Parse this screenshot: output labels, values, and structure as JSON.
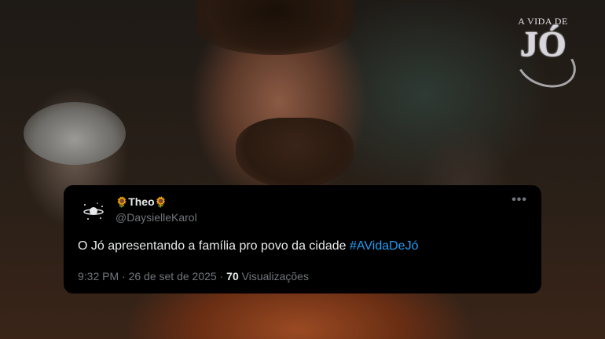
{
  "logo": {
    "top_text": "A VIDA DE",
    "main_text": "JÓ"
  },
  "tweet": {
    "display_name": "Theo",
    "name_emoji": "🌻",
    "handle": "@DaysielleKarol",
    "more_icon": "more-icon",
    "text": "O Jó apresentando a família pro povo da cidade ",
    "hashtag": "#AVidaDeJó",
    "time": "9:32 PM",
    "separator": "·",
    "date": "26 de set de 2025",
    "views_count": "70",
    "views_label": "Visualizações"
  },
  "colors": {
    "card_bg": "#000000",
    "text": "#e7e9ea",
    "muted": "#71767b",
    "link": "#1d9bf0"
  }
}
